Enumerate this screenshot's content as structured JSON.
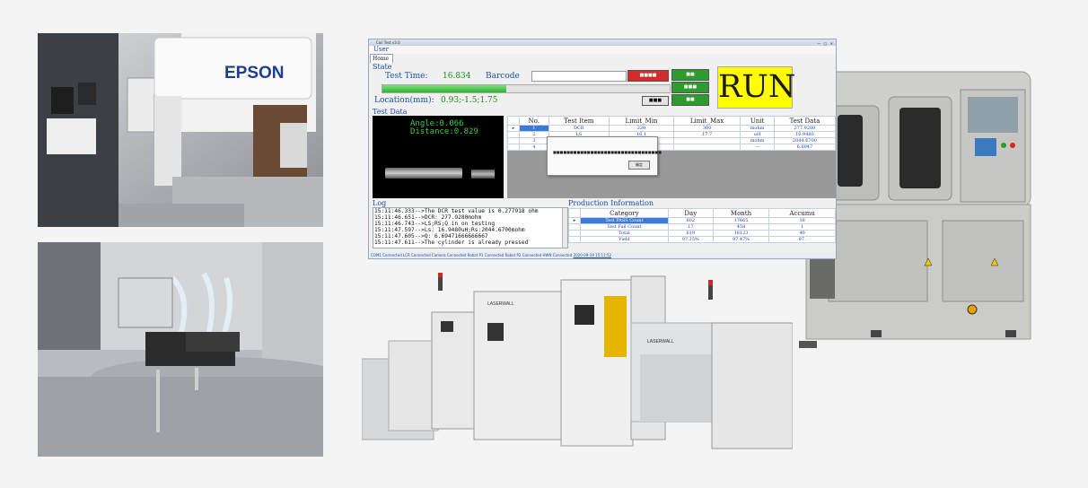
{
  "app": {
    "window_title": "Coil Test v3.0",
    "menu": [
      "User"
    ],
    "tabs": [
      "Home"
    ],
    "state_label": "State",
    "test_time_label": "Test Time:",
    "test_time_value": "16.834",
    "barcode_label": "Barcode",
    "location_label": "Location(mm):",
    "location_value": "0.93;-1.5;1.75",
    "run_text": "RUN",
    "test_data_label": "Test Data",
    "camera": {
      "angle": "Angle:0.066",
      "distance": "Distance:0.829"
    },
    "test_table": {
      "headers": [
        "No.",
        "Test Item",
        "Limit_Min",
        "Limit_Max",
        "Unit",
        "Test Data"
      ],
      "rows": [
        [
          "1",
          "DCR",
          "220",
          "300",
          "mohm",
          "277.9280"
        ],
        [
          "2",
          "LS",
          "16.1",
          "17.7",
          "uH",
          "16.9480"
        ],
        [
          "3",
          "RS",
          "",
          "",
          "mohm",
          "2044.6700"
        ],
        [
          "4",
          "Q",
          "",
          "",
          "---",
          "6.6947"
        ]
      ]
    },
    "log_label": "Log",
    "log_lines": [
      "15:11:46.333-->The DCR test value is 0.277918 ohm",
      "15:11:46.651-->DCR: 277.9280mohm",
      "15:11:46.743-->LS;RS;Q in on testing",
      "15:11:47.597-->Ls: 16.9480uH;Rs:2044.6700mohm",
      "15:11:47.605-->Q: 6.69471666666667",
      "15:11:47.611-->The cylinder is already pressed"
    ],
    "production_label": "Production Information",
    "prod_table": {
      "headers": [
        "Category",
        "Day",
        "Month",
        "Accumu"
      ],
      "rows": [
        [
          "Test PASS Count",
          "602",
          "17665",
          "18"
        ],
        [
          "Test Fail Count",
          "17",
          "458",
          "1"
        ],
        [
          "Total",
          "619",
          "18123",
          "40"
        ],
        [
          "Yield",
          "97.25%",
          "97.47%",
          "97."
        ]
      ]
    },
    "status_text": "COM1 Connected LCR Connected Camera Connected Robot P1 Connected Robot P2 Connected HWN Connected",
    "status_time": "2020-09-19 15:11:52",
    "dialog_ok": "确定"
  },
  "photos": [
    {
      "brand": "EPSON"
    },
    {
      "brand": "LASERWALL"
    },
    {
      "brand": "LASERWALL"
    }
  ],
  "colors": {
    "run_bg": "#ffff00",
    "green_button": "#2e9b2e",
    "red_button": "#d42a2a",
    "progress": "#3ec43e"
  }
}
